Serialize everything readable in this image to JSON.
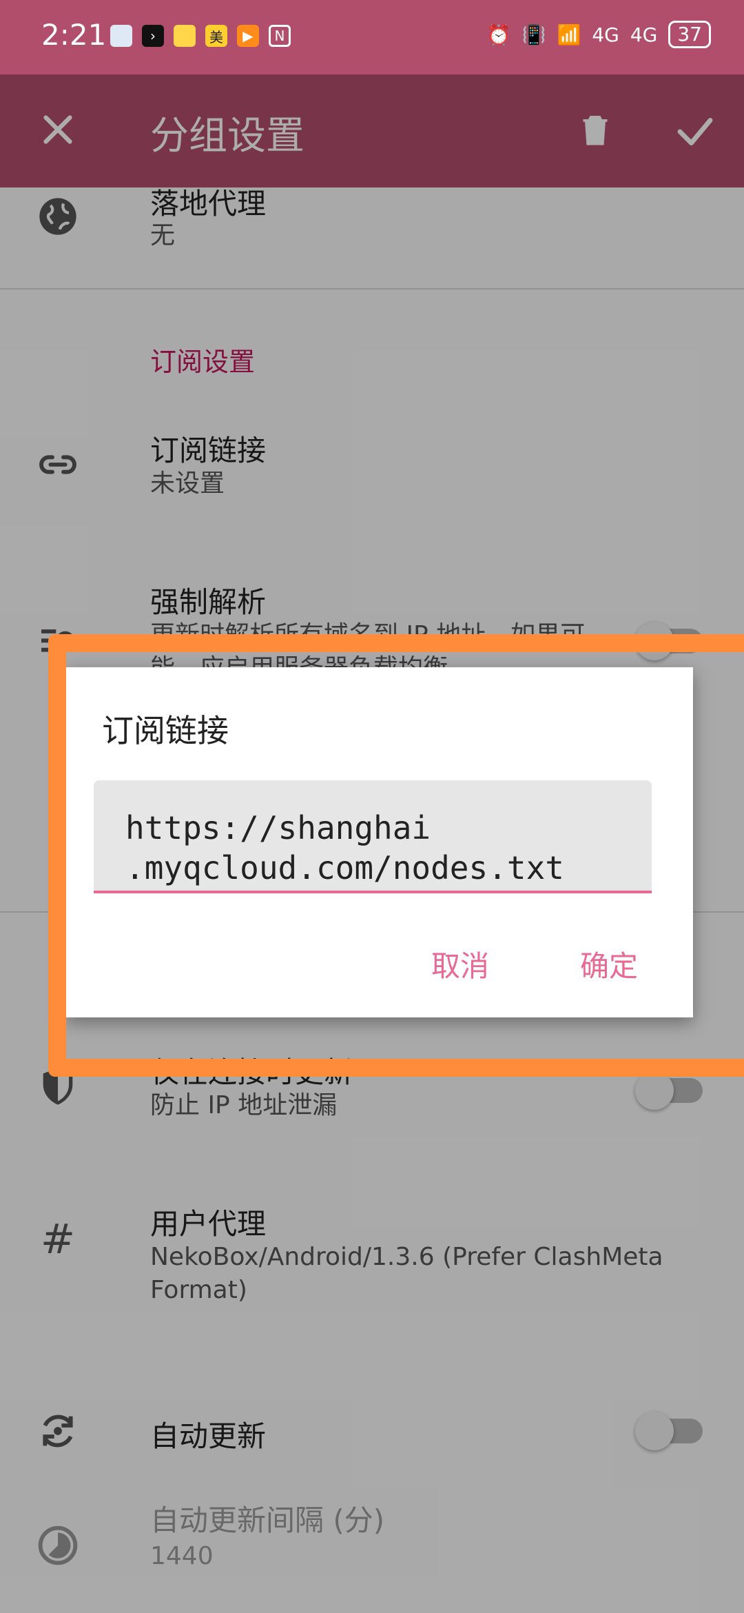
{
  "status_bar": {
    "time": "2:21",
    "battery": "37"
  },
  "app_bar": {
    "title": "分组设置"
  },
  "list": {
    "landing_proxy": {
      "title": "落地代理",
      "summary": "无"
    },
    "subscription_section": "订阅设置",
    "subscription_link": {
      "title": "订阅链接",
      "summary": "未设置"
    },
    "force_resolve": {
      "title": "强制解析",
      "summary": "更新时解析所有域名到 IP 地址。如果可能，应启用服务器负载均衡..."
    },
    "update_on_connect": {
      "title": "仅在连接时更新",
      "summary": "防止 IP 地址泄漏"
    },
    "user_agent": {
      "title": "用户代理",
      "summary": "NekoBox/Android/1.3.6 (Prefer ClashMeta Format)"
    },
    "auto_update": {
      "title": "自动更新"
    },
    "auto_update_interval": {
      "title": "自动更新间隔 (分)",
      "summary": "1440"
    }
  },
  "dialog": {
    "title": "订阅链接",
    "input_value": "https://shanghai\n.myqcloud.com/nodes.txt",
    "cancel_label": "取消",
    "ok_label": "确定"
  },
  "colors": {
    "primary": "#b14e6c",
    "accent": "#e86a92",
    "highlight": "#ff8c3a"
  }
}
